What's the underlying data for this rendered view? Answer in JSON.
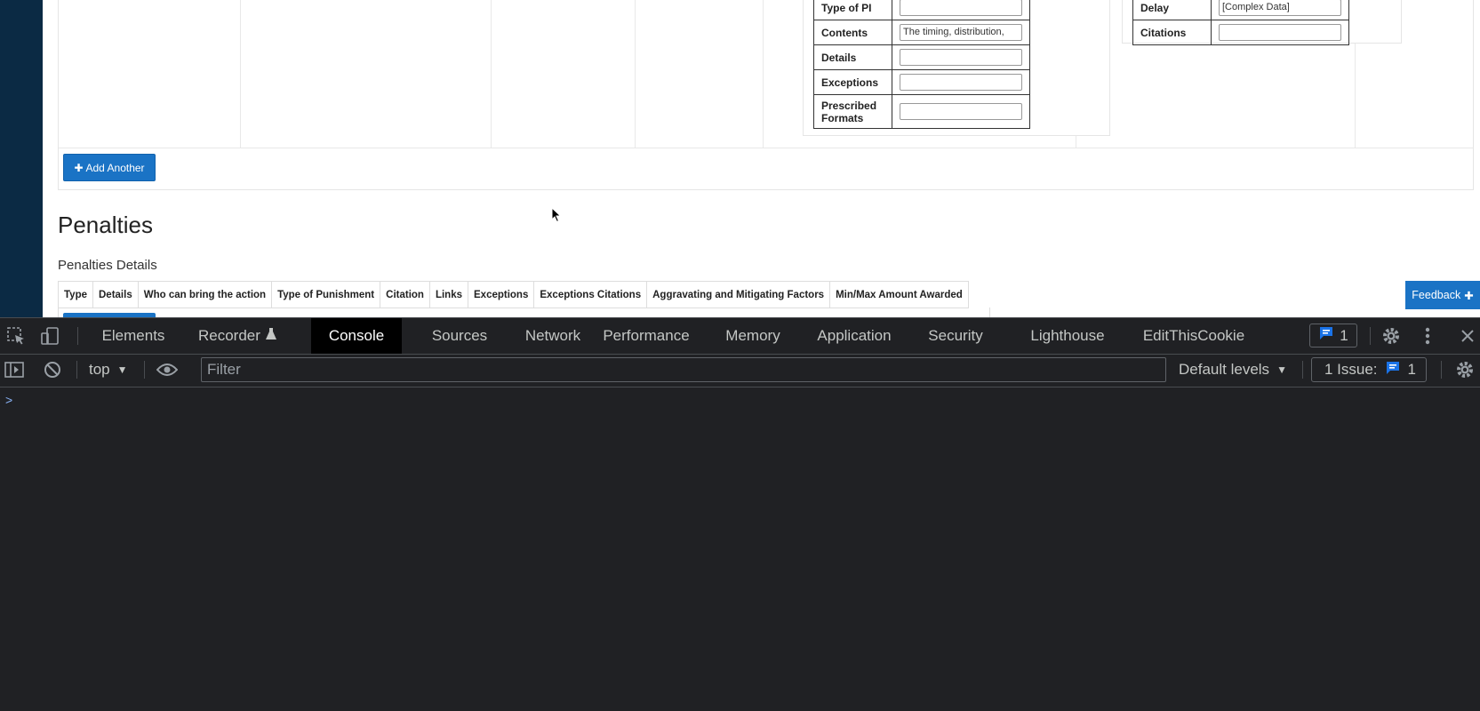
{
  "right_table": [
    {
      "key": "Type of PI",
      "value": ""
    },
    {
      "key": "Contents",
      "value": "The timing, distribution,"
    },
    {
      "key": "Details",
      "value": ""
    },
    {
      "key": "Exceptions",
      "value": ""
    },
    {
      "key": "Prescribed Formats",
      "value": ""
    }
  ],
  "far_table": [
    {
      "key": "Delay",
      "value": "[Complex Data]"
    },
    {
      "key": "Citations",
      "value": ""
    }
  ],
  "add_another_label": "Add Another",
  "penalties": {
    "heading": "Penalties",
    "subheading": "Penalties Details",
    "columns": [
      "Type",
      "Details",
      "Who can bring the action",
      "Type of Punishment",
      "Citation",
      "Links",
      "Exceptions",
      "Exceptions Citations",
      "Aggravating and Mitigating Factors",
      "Min/Max Amount Awarded"
    ]
  },
  "feedback_label": "Feedback",
  "devtools": {
    "tabs": [
      "Elements",
      "Recorder",
      "Console",
      "Sources",
      "Network",
      "Performance",
      "Memory",
      "Application",
      "Security",
      "Lighthouse",
      "EditThisCookie"
    ],
    "active_tab": "Console",
    "issues_count": "1",
    "context": "top",
    "filter_placeholder": "Filter",
    "levels": "Default levels",
    "issue_label": "1 Issue:",
    "issue_badge_count": "1",
    "prompt": ">"
  },
  "colors": {
    "primary": "#1a73c5",
    "sidebar": "#0b2a44",
    "devtools_bg": "#202124",
    "link_blue": "#8ab4f8"
  }
}
